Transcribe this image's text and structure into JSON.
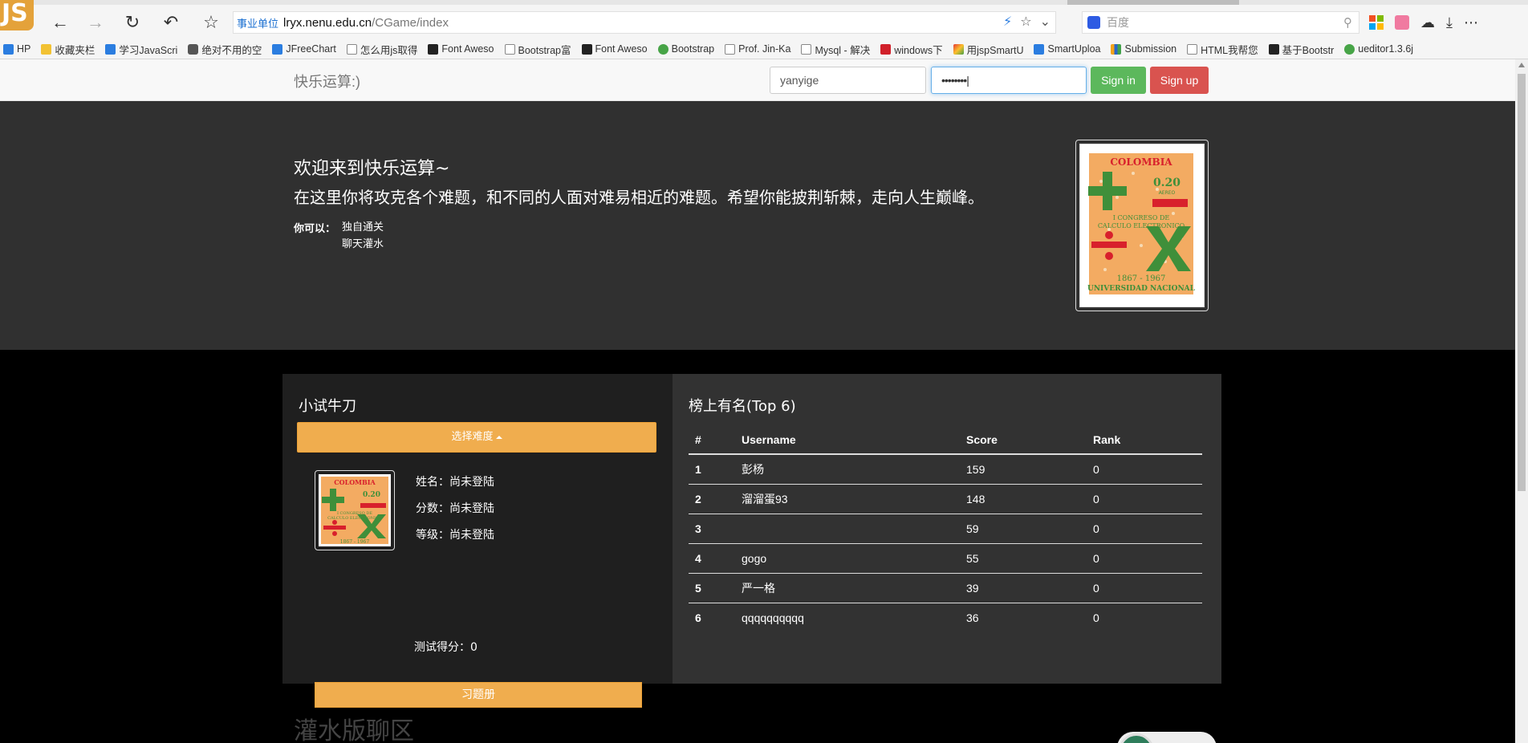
{
  "browser": {
    "address": {
      "badge": "事业单位",
      "host": "lryx.nenu.edu.cn",
      "path": "/CGame/index"
    },
    "search_placeholder": "百度",
    "js_logo": "JS",
    "bookmarks": [
      {
        "label": "HP",
        "kind": "blue"
      },
      {
        "label": "收藏夹栏",
        "kind": "folder"
      },
      {
        "label": "学习JavaScri",
        "kind": "blue"
      },
      {
        "label": "绝对不用的空",
        "kind": "robot"
      },
      {
        "label": "JFreeChart",
        "kind": "blue"
      },
      {
        "label": "怎么用js取得",
        "kind": "page"
      },
      {
        "label": "Font Aweso",
        "kind": "dark"
      },
      {
        "label": "Bootstrap富",
        "kind": "page"
      },
      {
        "label": "Font Aweso",
        "kind": "dark"
      },
      {
        "label": "Bootstrap",
        "kind": "green"
      },
      {
        "label": "Prof. Jin-Ka",
        "kind": "page"
      },
      {
        "label": "Mysql - 解决",
        "kind": "page"
      },
      {
        "label": "windows下",
        "kind": "red"
      },
      {
        "label": "用jspSmartU",
        "kind": "multi"
      },
      {
        "label": "SmartUploa",
        "kind": "blue"
      },
      {
        "label": "Submission",
        "kind": "bar"
      },
      {
        "label": "HTML我帮您",
        "kind": "page"
      },
      {
        "label": "基于Bootstr",
        "kind": "dark"
      },
      {
        "label": "ueditor1.3.6j",
        "kind": "green"
      }
    ]
  },
  "navbar": {
    "brand": "快乐运算:)",
    "username_value": "yanyige",
    "password_value": "••••••••|",
    "sign_in": "Sign in",
    "sign_up": "Sign up",
    "sign_in_color": "#5cb85c",
    "sign_up_color": "#d9534f"
  },
  "jumbotron": {
    "heading": "欢迎来到快乐运算~",
    "text": "在这里你将攻克各个难题，和不同的人面对难易相近的难题。希望你能披荆斩棘，走向人生巅峰。",
    "dl_term": "你可以：",
    "dl_items": [
      "独自通关",
      "聊天灌水"
    ]
  },
  "stamp": {
    "country": "COLOMBIA",
    "value": "0.20",
    "sub": "AEREO",
    "line1": "I CONGRESO DE",
    "line2": "CALCULO ELECTRONICO",
    "years": "1867 - 1967",
    "university": "UNIVERSIDAD NACIONAL"
  },
  "practice": {
    "title": "小试牛刀",
    "difficulty_button": "选择难度",
    "name_line": "姓名：尚未登陆",
    "score_line": "分数：尚未登陆",
    "level_line": "等级：尚未登陆",
    "test_score": "测试得分：0",
    "exercise_button": "习题册"
  },
  "leaderboard": {
    "title": "榜上有名(Top 6)",
    "columns": [
      "#",
      "Username",
      "Score",
      "Rank"
    ],
    "rows": [
      {
        "num": "1",
        "username": "彭杨",
        "score": "159",
        "rank": "0"
      },
      {
        "num": "2",
        "username": "溜溜蛋93",
        "score": "148",
        "rank": "0"
      },
      {
        "num": "3",
        "username": "",
        "score": "59",
        "rank": "0"
      },
      {
        "num": "4",
        "username": "gogo",
        "score": "55",
        "rank": "0"
      },
      {
        "num": "5",
        "username": "严一格",
        "score": "39",
        "rank": "0"
      },
      {
        "num": "6",
        "username": "qqqqqqqqqq",
        "score": "36",
        "rank": "0"
      }
    ]
  },
  "chat": {
    "title": "灌水版聊区"
  }
}
